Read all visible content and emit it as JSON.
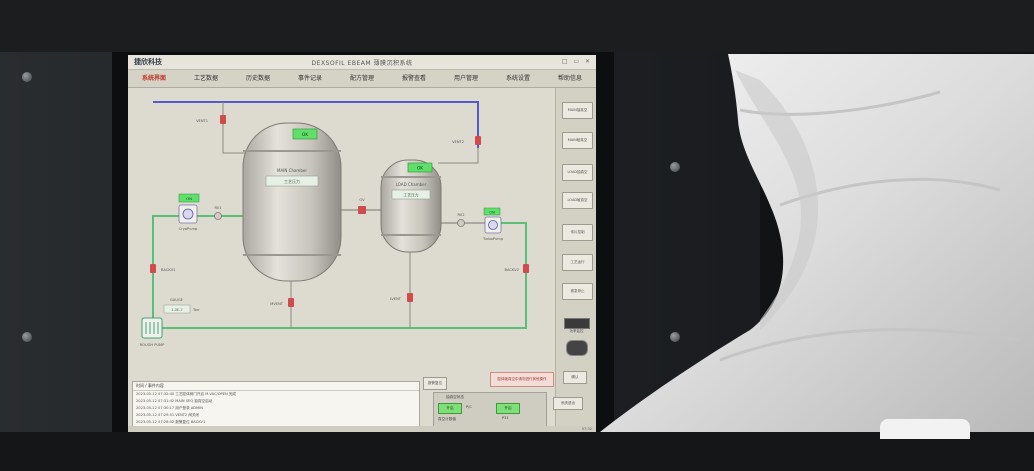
{
  "titlebar": {
    "logo": "捷欣科技",
    "title": "DEXSOFIL EBEAM 薄膜沉积系统",
    "controls": "□ ▭ ✕"
  },
  "nav": {
    "items": [
      {
        "label": "系统界面",
        "active": true
      },
      {
        "label": "工艺数据",
        "active": false
      },
      {
        "label": "历史数据",
        "active": false
      },
      {
        "label": "事件记录",
        "active": false
      },
      {
        "label": "配方管理",
        "active": false
      },
      {
        "label": "报警查看",
        "active": false
      },
      {
        "label": "用户管理",
        "active": false
      },
      {
        "label": "系统设置",
        "active": false
      },
      {
        "label": "帮助信息",
        "active": false
      }
    ]
  },
  "diagram": {
    "chamber_main": {
      "tag": "MAIN Chamber",
      "value_box": "工艺压力"
    },
    "chamber_load": {
      "tag": "LOAD Chamber",
      "value_box": "工艺压力"
    },
    "indicators": {
      "main_top": "OK",
      "load_top": "OK",
      "pump_left": "ON",
      "pump_right": "ON"
    },
    "labels": {
      "vent_left": "VENT1",
      "vent_right": "VENT2",
      "cryo_pump": "CryoPump",
      "turbo_pump": "TurboPump",
      "gate_valve": "GV",
      "roughing_left": "RV1",
      "roughing_right": "RV2",
      "backing_left": "BACKV1",
      "backing_right": "BACKV2",
      "rough_pump": "ROUGH PUMP",
      "main_gauge_label": "GAUGE",
      "main_gauge_value": "1.0E-7",
      "main_gauge_unit": "Torr",
      "vent_main_bottom": "MVENT",
      "vent_load_bottom": "LVENT"
    },
    "colors": {
      "pipe_vacuum": "#5bbf7a",
      "pipe_gas": "#5659c9",
      "valve_closed": "#d04b4b",
      "ok_green": "#5fe06a"
    }
  },
  "side_panel": {
    "buttons": [
      "MAIN抽真空",
      "MAIN破真空",
      "LOAD抽真空",
      "LOAD破真空",
      "传片控制",
      "工艺运行",
      "紧急停止"
    ],
    "icons": [
      "power-meter-icon",
      "camera-icon"
    ],
    "meter_label": "功率监控"
  },
  "log": {
    "header": "时间 / 事件内容",
    "rows": [
      "2023-05-12 07:32:40  工艺腔体阀门开启  M-VAC/OPEN 完成",
      "2023-05-12 07:31:42  MAIN SEQ 抽真空启动",
      "2023-05-12 07:30:17  用户登录 ADMIN",
      "2023-05-12 07:29:51  VENT2 阀关闭",
      "2023-05-12 07:28:02  报警复位 BACKV1"
    ]
  },
  "bottom_controls": {
    "log_button": "报警复位",
    "alarm_banner": "腔体破真空中请勿进行其他操作",
    "ack_button": "确认",
    "vac_title": "抽真空状态",
    "vac_left": "开启",
    "vac_right": "开启",
    "vac_mid": "P/C",
    "vac_pressure": "P31",
    "vac_unit": "真空计数值",
    "sys_button": "系统退出"
  },
  "statusbar": {
    "time": "07:32"
  }
}
